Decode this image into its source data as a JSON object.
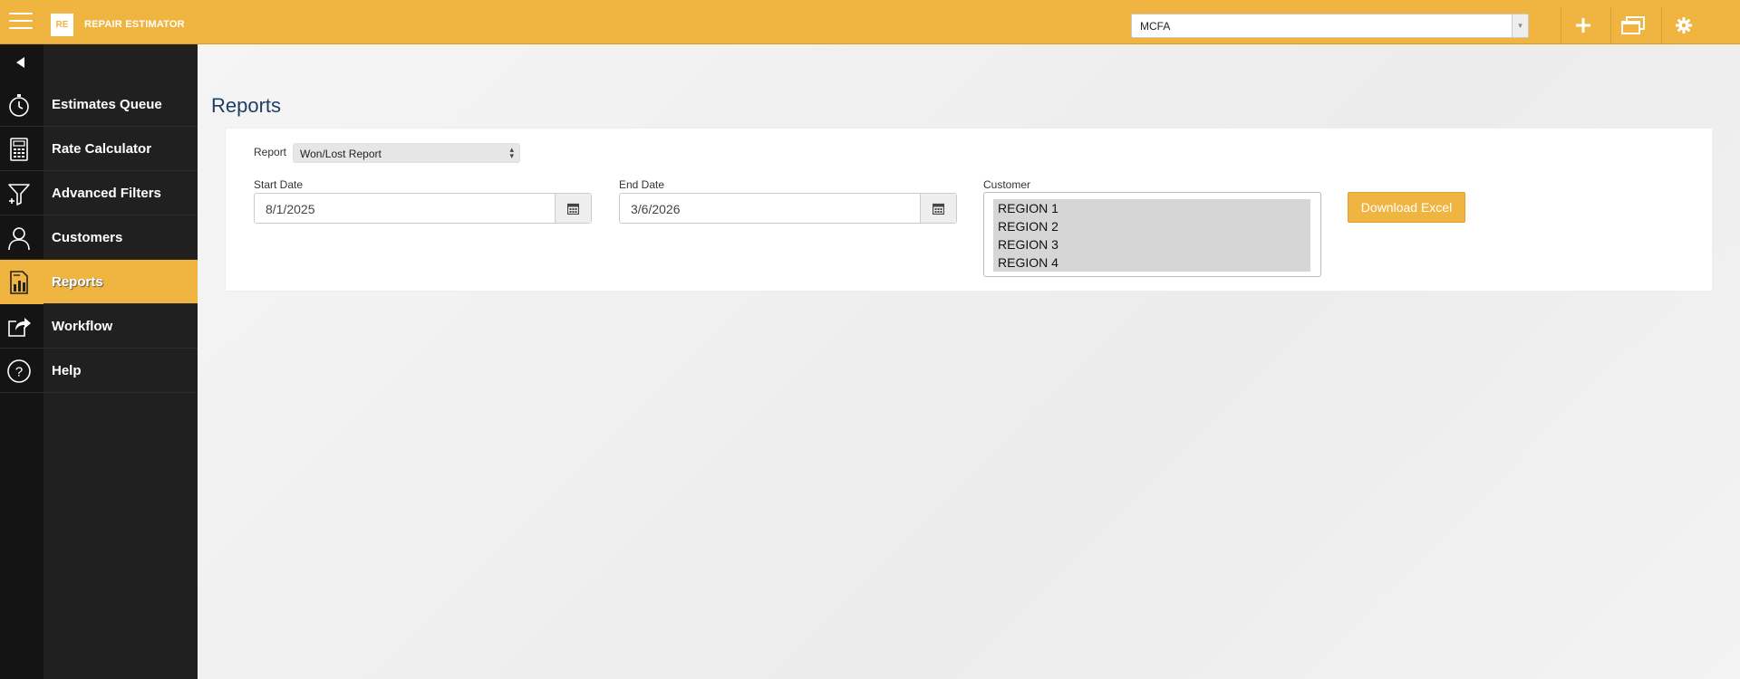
{
  "app": {
    "logo_text": "RE",
    "name": "REPAIR ESTIMATOR"
  },
  "topbar": {
    "org_select_value": "MCFA",
    "org_select_arrow": "▾"
  },
  "sidebar": {
    "items": [
      {
        "label": "Estimates Queue",
        "icon": "stopwatch-icon"
      },
      {
        "label": "Rate Calculator",
        "icon": "calculator-icon"
      },
      {
        "label": "Advanced Filters",
        "icon": "filter-icon"
      },
      {
        "label": "Customers",
        "icon": "user-icon"
      },
      {
        "label": "Reports",
        "icon": "report-icon",
        "active": true
      },
      {
        "label": "Workflow",
        "icon": "share-icon"
      },
      {
        "label": "Help",
        "icon": "help-icon"
      }
    ]
  },
  "main": {
    "title": "Reports",
    "report_label": "Report",
    "report_value": "Won/Lost Report",
    "start_date_label": "Start Date",
    "start_date_value": "8/1/2025",
    "end_date_label": "End Date",
    "end_date_value": "3/6/2026",
    "customer_label": "Customer",
    "customer_options": [
      "REGION 1",
      "REGION 2",
      "REGION 3",
      "REGION 4"
    ],
    "download_button": "Download Excel"
  },
  "colors": {
    "accent": "#f0b441",
    "sidebar": "#202020",
    "title": "#1e3f66"
  }
}
